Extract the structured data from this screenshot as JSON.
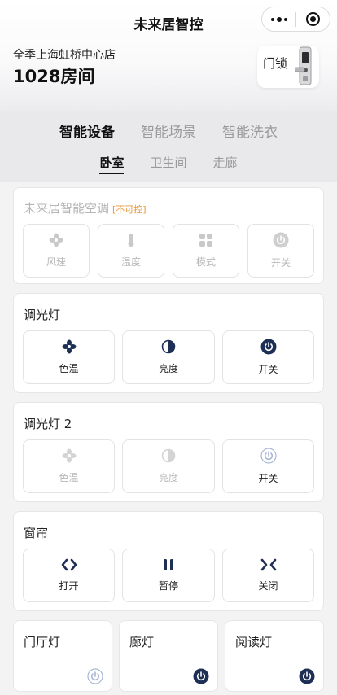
{
  "header": {
    "app_title": "未来居智控",
    "hotel_name": "全季上海虹桥中心店",
    "room": "1028房间",
    "door_lock_label": "门锁"
  },
  "main_tabs": [
    "智能设备",
    "智能场景",
    "智能洗衣"
  ],
  "sub_tabs": [
    "卧室",
    "卫生间",
    "走廊"
  ],
  "ac": {
    "title": "未来居智能空调",
    "badge": "[不可控]",
    "buttons": [
      "风速",
      "温度",
      "模式",
      "开关"
    ]
  },
  "dimmer1": {
    "title": "调光灯",
    "buttons": [
      "色温",
      "亮度",
      "开关"
    ]
  },
  "dimmer2": {
    "title": "调光灯 2",
    "buttons": [
      "色温",
      "亮度",
      "开关"
    ]
  },
  "curtain": {
    "title": "窗帘",
    "buttons": [
      "打开",
      "暂停",
      "关闭"
    ]
  },
  "lights": [
    "门厅灯",
    "廊灯",
    "阅读灯"
  ],
  "colors": {
    "accent": "#1e2f55",
    "disabled": "#c4c4c4",
    "warning": "#e89a3c"
  },
  "icons": {
    "ac": [
      "fan-icon",
      "thermometer-icon",
      "mode-grid-icon",
      "power-icon"
    ],
    "dimmer": [
      "color-temperature-icon",
      "brightness-icon",
      "power-icon"
    ],
    "curtain": [
      "curtain-open-icon",
      "pause-icon",
      "curtain-close-icon"
    ]
  }
}
